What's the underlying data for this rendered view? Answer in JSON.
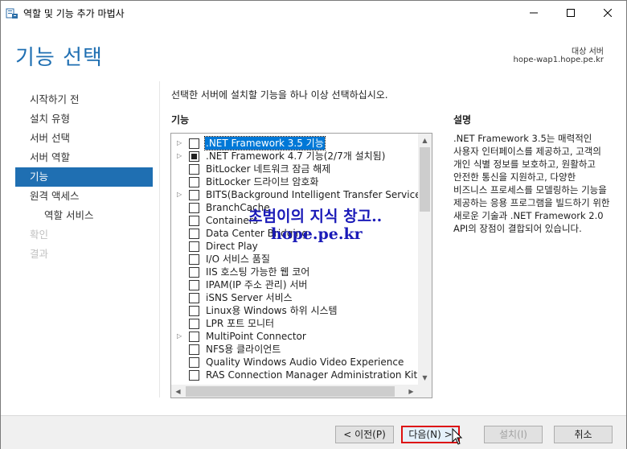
{
  "window": {
    "title": "역할 및 기능 추가 마법사"
  },
  "header": {
    "page_title": "기능 선택",
    "target_label": "대상 서버",
    "target_value": "hope-wap1.hope.pe.kr"
  },
  "nav": {
    "items": [
      {
        "label": "시작하기 전",
        "state": "normal"
      },
      {
        "label": "설치 유형",
        "state": "normal"
      },
      {
        "label": "서버 선택",
        "state": "normal"
      },
      {
        "label": "서버 역할",
        "state": "normal"
      },
      {
        "label": "기능",
        "state": "active"
      },
      {
        "label": "원격 액세스",
        "state": "normal"
      },
      {
        "label": "역할 서비스",
        "state": "sub"
      },
      {
        "label": "확인",
        "state": "disabled"
      },
      {
        "label": "결과",
        "state": "disabled"
      }
    ]
  },
  "main": {
    "instruction": "선택한 서버에 설치할 기능을 하나 이상 선택하십시오.",
    "features_header": "기능",
    "features": [
      {
        "label": ".NET Framework 3.5 기능",
        "expandable": true,
        "checked": "none",
        "selected": true
      },
      {
        "label": ".NET Framework 4.7 기능(2/7개 설치됨)",
        "expandable": true,
        "checked": "partial",
        "selected": false
      },
      {
        "label": "BitLocker 네트워크 잠금 해제",
        "expandable": false,
        "checked": "none",
        "selected": false
      },
      {
        "label": "BitLocker 드라이브 암호화",
        "expandable": false,
        "checked": "none",
        "selected": false
      },
      {
        "label": "BITS(Background Intelligent Transfer Service)",
        "expandable": true,
        "checked": "none",
        "selected": false
      },
      {
        "label": "BranchCache",
        "expandable": false,
        "checked": "none",
        "selected": false
      },
      {
        "label": "Containers",
        "expandable": false,
        "checked": "none",
        "selected": false
      },
      {
        "label": "Data Center Bridging",
        "expandable": false,
        "checked": "none",
        "selected": false
      },
      {
        "label": "Direct Play",
        "expandable": false,
        "checked": "none",
        "selected": false
      },
      {
        "label": "I/O 서비스 품질",
        "expandable": false,
        "checked": "none",
        "selected": false
      },
      {
        "label": "IIS 호스팅 가능한 웹 코어",
        "expandable": false,
        "checked": "none",
        "selected": false
      },
      {
        "label": "IPAM(IP 주소 관리) 서버",
        "expandable": false,
        "checked": "none",
        "selected": false
      },
      {
        "label": "iSNS Server 서비스",
        "expandable": false,
        "checked": "none",
        "selected": false
      },
      {
        "label": "Linux용 Windows 하위 시스템",
        "expandable": false,
        "checked": "none",
        "selected": false
      },
      {
        "label": "LPR 포트 모니터",
        "expandable": false,
        "checked": "none",
        "selected": false
      },
      {
        "label": "MultiPoint Connector",
        "expandable": true,
        "checked": "none",
        "selected": false
      },
      {
        "label": "NFS용 클라이언트",
        "expandable": false,
        "checked": "none",
        "selected": false
      },
      {
        "label": "Quality Windows Audio Video Experience",
        "expandable": false,
        "checked": "none",
        "selected": false
      },
      {
        "label": "RAS Connection Manager Administration Kit (CM",
        "expandable": false,
        "checked": "none",
        "selected": false
      }
    ],
    "description_header": "설명",
    "description_text": ".NET Framework 3.5는 매력적인 사용자 인터페이스를 제공하고, 고객의 개인 식별 정보를 보호하고, 원활하고 안전한 통신을 지원하고, 다양한 비즈니스 프로세스를 모델링하는 기능을 제공하는 응용 프로그램을 빌드하기 위한 새로운 기술과 .NET Framework 2.0 API의 장점이 결합되어 있습니다."
  },
  "watermark": {
    "line1": "초범이의 지식 창고..",
    "line2": "hope.pe.kr"
  },
  "footer": {
    "prev_label": "< 이전(P)",
    "next_label": "다음(N) >",
    "install_label": "설치(I)",
    "cancel_label": "취소"
  },
  "colors": {
    "accent": "#1f6fb2",
    "selection": "#0078d7",
    "highlight_border": "#dd1111",
    "watermark": "#1a1ab8"
  }
}
